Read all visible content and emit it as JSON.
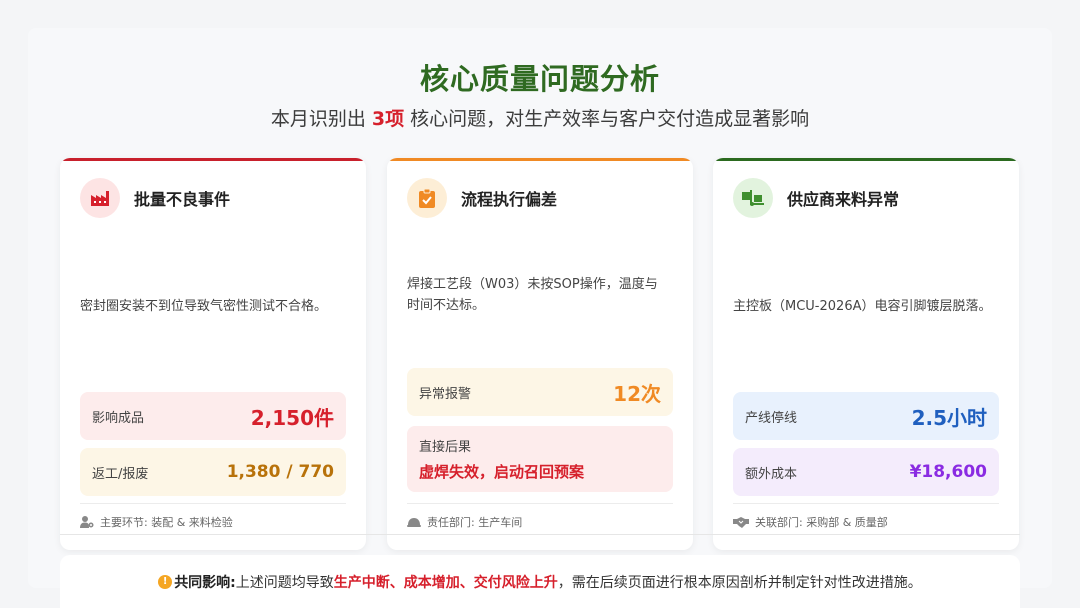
{
  "header": {
    "title": "核心质量问题分析",
    "subtitle_pre": "本月识别出 ",
    "subtitle_highlight": "3项",
    "subtitle_post": " 核心问题，对生产效率与客户交付造成显著影响"
  },
  "colors": {
    "title_green": "#2f6a21",
    "accent_red": "#d6202c",
    "accent_orange": "#f08a24",
    "accent_green": "#2b6a1f",
    "blue": "#1f5fbf",
    "purple": "#8a2be2"
  },
  "cards": [
    {
      "icon": "factory-icon",
      "title": "批量不良事件",
      "description": "密封圈安装不到位导致气密性测试不合格。",
      "metrics": [
        {
          "label": "影响成品",
          "value": "2,150件"
        },
        {
          "label": "返工/报废",
          "value": "1,380 / 770"
        }
      ],
      "footer_icon": "user-gear-icon",
      "footer": "主要环节: 装配 & 来料检验"
    },
    {
      "icon": "clipboard-check-icon",
      "title": "流程执行偏差",
      "description": "焊接工艺段（W03）未按SOP操作，温度与时间不达标。",
      "metrics": [
        {
          "label": "异常报警",
          "value": "12次"
        },
        {
          "label": "直接后果",
          "value": "虚焊失效，启动召回预案"
        }
      ],
      "footer_icon": "hard-hat-icon",
      "footer": "责任部门: 生产车间"
    },
    {
      "icon": "truck-loading-icon",
      "title": "供应商来料异常",
      "description": "主控板（MCU-2026A）电容引脚镀层脱落。",
      "metrics": [
        {
          "label": "产线停线",
          "value": "2.5小时"
        },
        {
          "label": "额外成本",
          "value": "¥18,600"
        }
      ],
      "footer_icon": "handshake-icon",
      "footer": "关联部门: 采购部 & 质量部"
    }
  ],
  "summary": {
    "icon": "warning-icon",
    "label": "共同影响:",
    "pre": " 上述问题均导致 ",
    "highlight": "生产中断、成本增加、交付风险上升",
    "post": "，需在后续页面进行根本原因剖析并制定针对性改进措施。"
  }
}
